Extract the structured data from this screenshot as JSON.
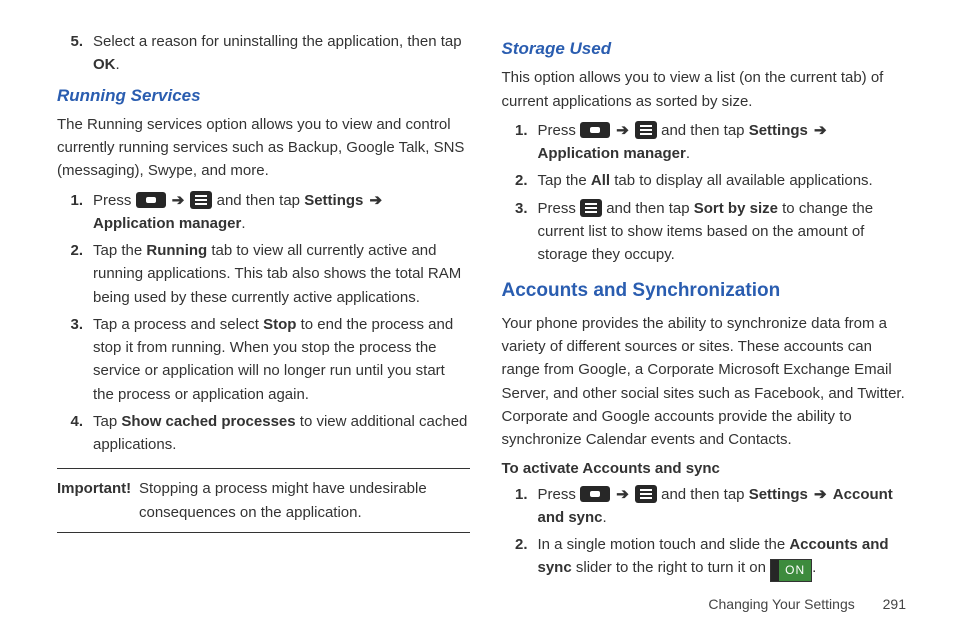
{
  "left": {
    "step5_pre": "Select a reason for uninstalling the application, then tap ",
    "step5_b": "OK",
    "step5_post": ".",
    "running_h": "Running Services",
    "running_p": "The Running services option allows you to view and control currently running services such as Backup, Google Talk, SNS (messaging), Swype, and more.",
    "r1_pre": "Press ",
    "r1_mid": " and then tap ",
    "r1_b1": "Settings",
    "r1_b2": "Application manager",
    "r1_post": ".",
    "r2_pre": "Tap the ",
    "r2_b": "Running",
    "r2_post": " tab to view all currently active and running applications. This tab also shows the total RAM being used by these currently active applications.",
    "r3_pre": "Tap a process and select ",
    "r3_b": "Stop",
    "r3_post": " to end the process and stop it from running. When you stop the process the service or application will no longer run until you start the process or application again.",
    "r4_pre": "Tap ",
    "r4_b": "Show cached processes",
    "r4_post": " to view additional cached applications.",
    "imp_label": "Important!",
    "imp_text": "Stopping a process might have undesirable consequences on the application."
  },
  "right": {
    "storage_h": "Storage Used",
    "storage_p": "This option allows you to view a list (on the current tab) of current applications as sorted by size.",
    "s1_pre": "Press ",
    "s1_mid": " and then tap ",
    "s1_b1": "Settings",
    "s1_b2": "Application manager",
    "s1_post": ".",
    "s2_pre": "Tap the ",
    "s2_b": "All",
    "s2_post": " tab to display all available applications.",
    "s3_pre": "Press ",
    "s3_mid": " and then tap ",
    "s3_b": "Sort by size",
    "s3_post": " to change the current list to show items based on the amount of storage they occupy.",
    "acc_h": "Accounts and Synchronization",
    "acc_p": "Your phone provides the ability to synchronize data from a variety of different sources or sites. These accounts can range from Google, a Corporate Microsoft Exchange Email Server, and other social sites such as Facebook, and Twitter. Corporate and Google accounts provide the ability to synchronize Calendar events and Contacts.",
    "acc_sub": "To activate Accounts and sync",
    "a1_pre": "Press ",
    "a1_mid": " and then tap ",
    "a1_b1": "Settings",
    "a1_b2": "Account and sync",
    "a1_post": ".",
    "a2_pre": "In a single motion touch and slide the ",
    "a2_b": "Accounts and sync",
    "a2_mid": " slider to the right to turn it on ",
    "a2_on": "ON",
    "a2_post": "."
  },
  "footer": {
    "section": "Changing Your Settings",
    "page": "291"
  },
  "nums": {
    "n1": "1.",
    "n2": "2.",
    "n3": "3.",
    "n4": "4.",
    "n5": "5."
  },
  "arrow": "➔"
}
